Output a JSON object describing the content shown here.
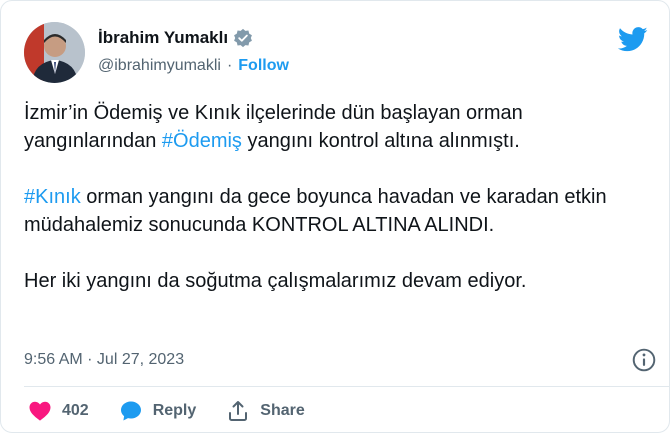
{
  "user": {
    "display_name": "İbrahim Yumaklı",
    "handle": "@ibrahimyumakli",
    "separator": "·",
    "follow_label": "Follow"
  },
  "tweet": {
    "p1_part1": "İzmir’in Ödemiş ve Kınık ilçelerinde dün başlayan orman yangınlarından ",
    "p1_hashtag": "#Ödemiş",
    "p1_part2": " yangını kontrol altına alınmıştı.",
    "p2_hashtag": "#Kınık",
    "p2_part1": " orman yangını da gece boyunca havadan ve karadan etkin müdahalemiz sonucunda KONTROL ALTINA ALINDI.",
    "p3": "Her iki yangını da soğutma çalışmalarımız devam ediyor.",
    "timestamp": "9:56 AM · Jul 27, 2023"
  },
  "actions": {
    "like_count": "402",
    "reply_label": "Reply",
    "share_label": "Share"
  },
  "colors": {
    "accent": "#1d9bf0",
    "like": "#f91880",
    "secondary_text": "#536471",
    "verified_badge": "#829aab"
  },
  "icons": [
    "verified-badge-icon",
    "twitter-bird-icon",
    "info-icon",
    "heart-icon",
    "reply-bubble-icon",
    "share-icon"
  ]
}
